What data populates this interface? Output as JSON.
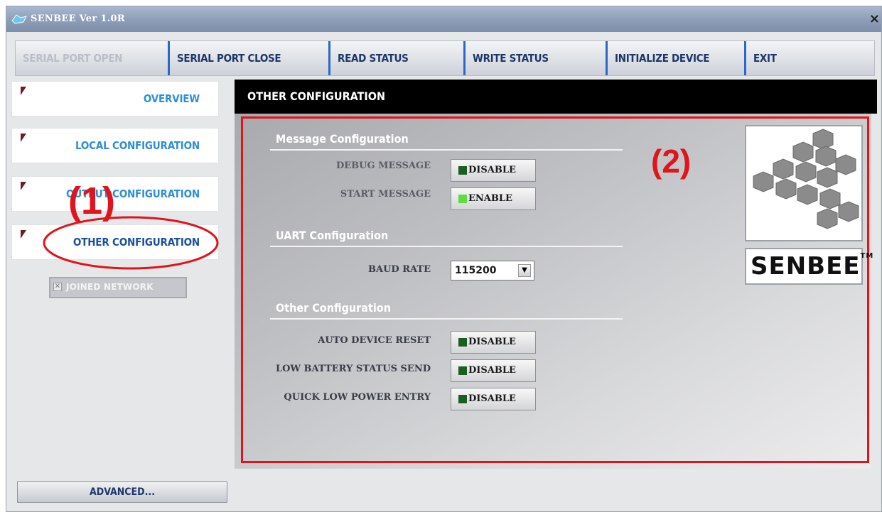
{
  "window": {
    "title": "SENBEE Ver 1.0R",
    "close": "×"
  },
  "toolbar": {
    "serial_open": "SERIAL PORT OPEN",
    "serial_close": "SERIAL PORT CLOSE",
    "read_status": "READ STATUS",
    "write_status": "WRITE STATUS",
    "initialize": "INITIALIZE DEVICE",
    "exit": "EXIT"
  },
  "sidebar": {
    "items": [
      {
        "label": "OVERVIEW"
      },
      {
        "label": "LOCAL CONFIGURATION"
      },
      {
        "label": "OUTPUT CONFIGURATION"
      },
      {
        "label": "OTHER CONFIGURATION",
        "selected": true
      }
    ],
    "joined_network": "JOINED NETWORK",
    "advanced": "ADVANCED..."
  },
  "main": {
    "header": "OTHER CONFIGURATION",
    "sections": {
      "message": "Message Configuration",
      "uart": "UART Configuration",
      "other": "Other Configuration"
    },
    "debug_message": {
      "label": "DEBUG MESSAGE",
      "value": "DISABLE"
    },
    "start_message": {
      "label": "START MESSAGE",
      "value": "ENABLE"
    },
    "baud_rate": {
      "label": "BAUD RATE",
      "value": "115200"
    },
    "auto_reset": {
      "label": "AUTO DEVICE RESET",
      "value": "DISABLE"
    },
    "low_battery": {
      "label": "LOW BATTERY STATUS SEND",
      "value": "DISABLE"
    },
    "quick_low_power": {
      "label": "QUICK LOW POWER ENTRY",
      "value": "DISABLE"
    }
  },
  "logo": {
    "brand": "SENBEE",
    "tm": "TM"
  },
  "annotations": {
    "one": "(1)",
    "two": "(2)"
  },
  "colors": {
    "annotation": "#e0141c",
    "header_bg": "#000000",
    "accent": "#2c67c8",
    "led_on": "#5fdc42",
    "led_off": "#1c5e22"
  }
}
